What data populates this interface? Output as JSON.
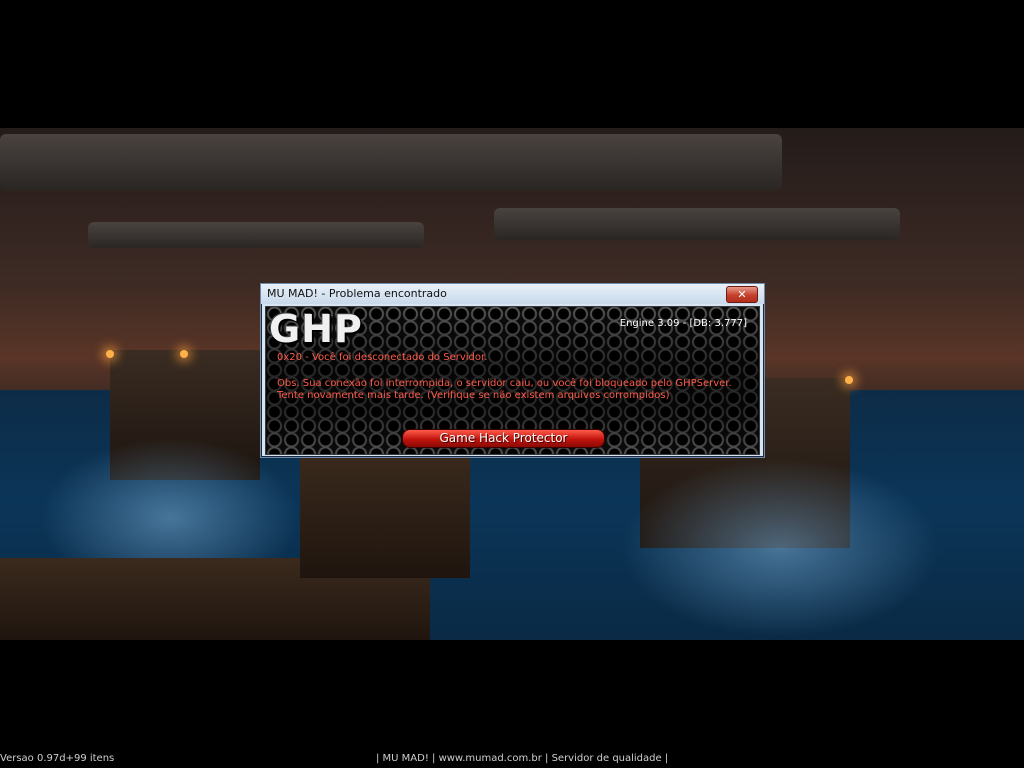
{
  "window": {
    "title": "MU MAD! - Problema encontrado",
    "close_label": "✕"
  },
  "dialog": {
    "logo": "GHP",
    "engine": "Engine 3.09 - [DB: 3.777]",
    "error_line": "0x20 - Você foi desconectado do Servidor.",
    "note_line1": "Obs. Sua conexão foi interrompida, o servidor caiu, ou você foi bloqueado pelo GHPServer.",
    "note_line2": "Tente novamente mais tarde. (Verifique se não existem arquivos corrompidos)",
    "button_label": "Game Hack Protector"
  },
  "footer": {
    "version": "Versao 0.97d+99 itens",
    "server": "| MU MAD! | www.mumad.com.br | Servidor de qualidade |"
  },
  "colors": {
    "message_text": "#ff5a4a",
    "button": "#c0140c"
  }
}
